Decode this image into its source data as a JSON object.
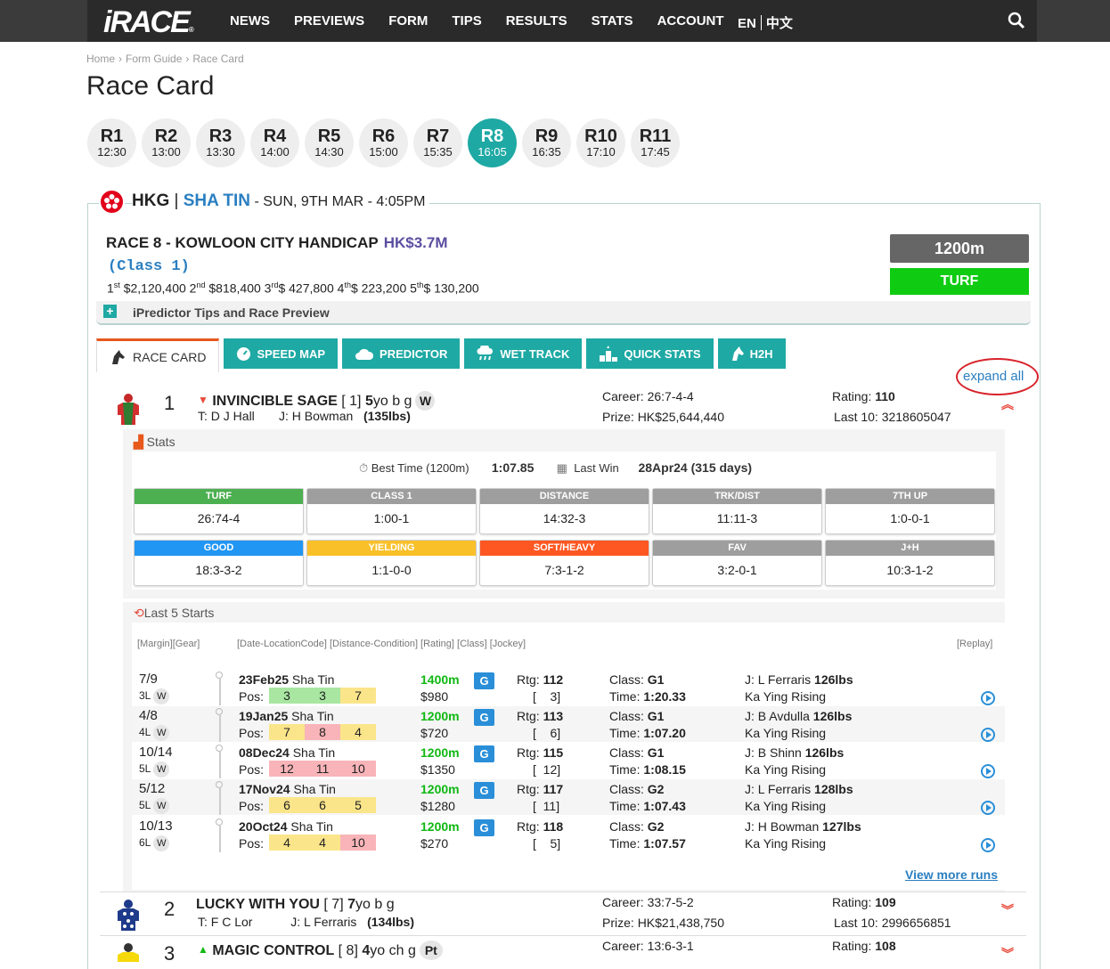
{
  "nav": {
    "logo": "iRACE",
    "logo_r": "®",
    "items": [
      "NEWS",
      "PREVIEWS",
      "FORM",
      "TIPS",
      "RESULTS",
      "STATS",
      "ACCOUNT"
    ],
    "lang_en": "EN",
    "lang_zh": "中文"
  },
  "breadcrumb": [
    "Home",
    "›",
    "Form Guide",
    "›",
    "Race Card"
  ],
  "page_title": "Race Card",
  "races": [
    {
      "n": "R1",
      "t": "12:30"
    },
    {
      "n": "R2",
      "t": "13:00"
    },
    {
      "n": "R3",
      "t": "13:30"
    },
    {
      "n": "R4",
      "t": "14:00"
    },
    {
      "n": "R5",
      "t": "14:30"
    },
    {
      "n": "R6",
      "t": "15:00"
    },
    {
      "n": "R7",
      "t": "15:35"
    },
    {
      "n": "R8",
      "t": "16:05",
      "active": true
    },
    {
      "n": "R9",
      "t": "16:35"
    },
    {
      "n": "R10",
      "t": "17:10"
    },
    {
      "n": "R11",
      "t": "17:45"
    }
  ],
  "meeting": {
    "country": "HKG",
    "sep": " | ",
    "venue": "SHA TIN",
    "datetime": " - SUN, 9TH MAR - 4:05PM"
  },
  "race": {
    "name": "RACE 8 - KOWLOON CITY HANDICAP",
    "purse": "HK$3.7M",
    "class": "(Class 1)",
    "distance": "1200m",
    "surface": "TURF",
    "prizes": [
      {
        "p": "1",
        "s": "st",
        "v": " $2,120,400 "
      },
      {
        "p": "2",
        "s": "nd",
        "v": " $818,400 "
      },
      {
        "p": "3",
        "s": "rd",
        "v": "$ 427,800 "
      },
      {
        "p": "4",
        "s": "th",
        "v": "$ 223,200 "
      },
      {
        "p": "5",
        "s": "th",
        "v": "$ 130,200"
      }
    ]
  },
  "ipredictor": {
    "plus": "+",
    "label": "iPredictor Tips and Race Preview"
  },
  "tabs": [
    "RACE CARD",
    "SPEED MAP",
    "PREDICTOR",
    "WET TRACK",
    "QUICK STATS",
    "H2H"
  ],
  "expand_all": "expand all",
  "horses": [
    {
      "num": "1",
      "arrow": "▼",
      "name": "INVINCIBLE SAGE",
      "barrier": " [ 1] ",
      "age": "5",
      "sex": "yo b g",
      "badge": "W",
      "trainer": "T: D J Hall",
      "jockey": "J:  H Bowman",
      "weight": "(135lbs)",
      "career_label": "Career: ",
      "career": "26:7-4-4",
      "prize_label": "Prize: ",
      "prize": "HK$25,644,440",
      "rating_label": "Rating: ",
      "rating": "110",
      "last10_label": "Last 10: ",
      "last10": "3218605047"
    },
    {
      "num": "2",
      "arrow": "",
      "name": "LUCKY WITH YOU",
      "barrier": " [ 7] ",
      "age": "7",
      "sex": "yo b g",
      "badge": "",
      "trainer": "T: F C Lor",
      "jockey": "J:  L Ferraris",
      "weight": "(134lbs)",
      "career_label": "Career: ",
      "career": "33:7-5-2",
      "prize_label": "Prize: ",
      "prize": "HK$21,438,750",
      "rating_label": "Rating: ",
      "rating": "109",
      "last10_label": "Last 10: ",
      "last10": "2996656851"
    },
    {
      "num": "3",
      "arrow": "▲",
      "name": "MAGIC CONTROL",
      "barrier": " [ 8] ",
      "age": "4",
      "sex": "yo ch g",
      "badge": "Pt",
      "trainer": "",
      "jockey": "",
      "weight": "",
      "career_label": "Career: ",
      "career": "13:6-3-1",
      "prize_label": "",
      "prize": "",
      "rating_label": "Rating: ",
      "rating": "108",
      "last10_label": "",
      "last10": ""
    }
  ],
  "stats": {
    "heading": "Stats",
    "best_label": "Best Time (1200m)",
    "best_time": "1:07.85",
    "lastwin_label": "Last Win",
    "last_win": "28Apr24 (315 days)",
    "cells": [
      {
        "h": "TURF",
        "v": "26:74-4",
        "c": "#4caf50"
      },
      {
        "h": "CLASS 1",
        "v": "1:00-1",
        "c": "#9e9e9e"
      },
      {
        "h": "DISTANCE",
        "v": "14:32-3",
        "c": "#9e9e9e"
      },
      {
        "h": "TRK/DIST",
        "v": "11:11-3",
        "c": "#9e9e9e"
      },
      {
        "h": "7TH UP",
        "v": "1:0-0-1",
        "c": "#9e9e9e"
      },
      {
        "h": "GOOD",
        "v": "18:3-3-2",
        "c": "#2196f3"
      },
      {
        "h": "YIELDING",
        "v": "1:1-0-0",
        "c": "#f9c02a"
      },
      {
        "h": "SOFT/HEAVY",
        "v": "7:3-1-2",
        "c": "#ff5722"
      },
      {
        "h": "FAV",
        "v": "3:2-0-1",
        "c": "#9e9e9e"
      },
      {
        "h": "J+H",
        "v": "10:3-1-2",
        "c": "#9e9e9e"
      }
    ]
  },
  "last5": {
    "heading": "Last 5 Starts",
    "col1": "[Margin][Gear]",
    "col2": "[Date-LocationCode] [Distance-Condition] [Rating] [Class] [Jockey]",
    "col3": "[Replay]",
    "runs": [
      {
        "plc": "7/9",
        "mg": "3L",
        "gear": "W",
        "date": "23Feb25",
        "loc": " Sha Tin",
        "pos": [
          "3",
          "3",
          "7"
        ],
        "pc": [
          "#a8e6a1",
          "#a8e6a1",
          "#fbe58a"
        ],
        "dist": "1400m",
        "money": "$980",
        "cond": "G",
        "rtg": "112",
        "rtgb": "[    3]",
        "cls": "G1",
        "time": "1:20.33",
        "jockey": "J: L Ferraris ",
        "jw": "126lbs",
        "horse": "Ka Ying Rising"
      },
      {
        "plc": "4/8",
        "mg": "4L",
        "gear": "W",
        "date": "19Jan25",
        "loc": " Sha Tin",
        "pos": [
          "7",
          "8",
          "4"
        ],
        "pc": [
          "#fbe58a",
          "#f8b4b8",
          "#fbe58a"
        ],
        "dist": "1200m",
        "money": "$720",
        "cond": "G",
        "rtg": "113",
        "rtgb": "[    6]",
        "cls": "G1",
        "time": "1:07.20",
        "jockey": "J: B Avdulla ",
        "jw": "126lbs",
        "horse": "Ka Ying Rising"
      },
      {
        "plc": "10/14",
        "mg": "5L",
        "gear": "W",
        "date": "08Dec24",
        "loc": " Sha Tin",
        "pos": [
          "12",
          "11",
          "10"
        ],
        "pc": [
          "#f8b4b8",
          "#f8b4b8",
          "#f8b4b8"
        ],
        "dist": "1200m",
        "money": "$1350",
        "cond": "G",
        "rtg": "115",
        "rtgb": "[  12]",
        "cls": "G1",
        "time": "1:08.15",
        "jockey": "J: B Shinn ",
        "jw": "126lbs",
        "horse": "Ka Ying Rising"
      },
      {
        "plc": "5/12",
        "mg": "5L",
        "gear": "W",
        "date": "17Nov24",
        "loc": " Sha Tin",
        "pos": [
          "6",
          "6",
          "5"
        ],
        "pc": [
          "#fbe58a",
          "#fbe58a",
          "#fbe58a"
        ],
        "dist": "1200m",
        "money": "$1280",
        "cond": "G",
        "rtg": "117",
        "rtgb": "[  11]",
        "cls": "G2",
        "time": "1:07.43",
        "jockey": "J: L Ferraris ",
        "jw": "128lbs",
        "horse": "Ka Ying Rising"
      },
      {
        "plc": "10/13",
        "mg": "6L",
        "gear": "W",
        "date": "20Oct24",
        "loc": " Sha Tin",
        "pos": [
          "4",
          "4",
          "10"
        ],
        "pc": [
          "#fbe58a",
          "#fbe58a",
          "#f8b4b8"
        ],
        "dist": "1200m",
        "money": "$270",
        "cond": "G",
        "rtg": "118",
        "rtgb": "[    5]",
        "cls": "G2",
        "time": "1:07.57",
        "jockey": "J: H Bowman ",
        "jw": "127lbs",
        "horse": "Ka Ying Rising"
      }
    ],
    "view_more": "View more runs",
    "pos_label": "Pos:",
    "rtg_label": "Rtg: ",
    "cls_label": "Class: ",
    "time_label": "Time: "
  }
}
